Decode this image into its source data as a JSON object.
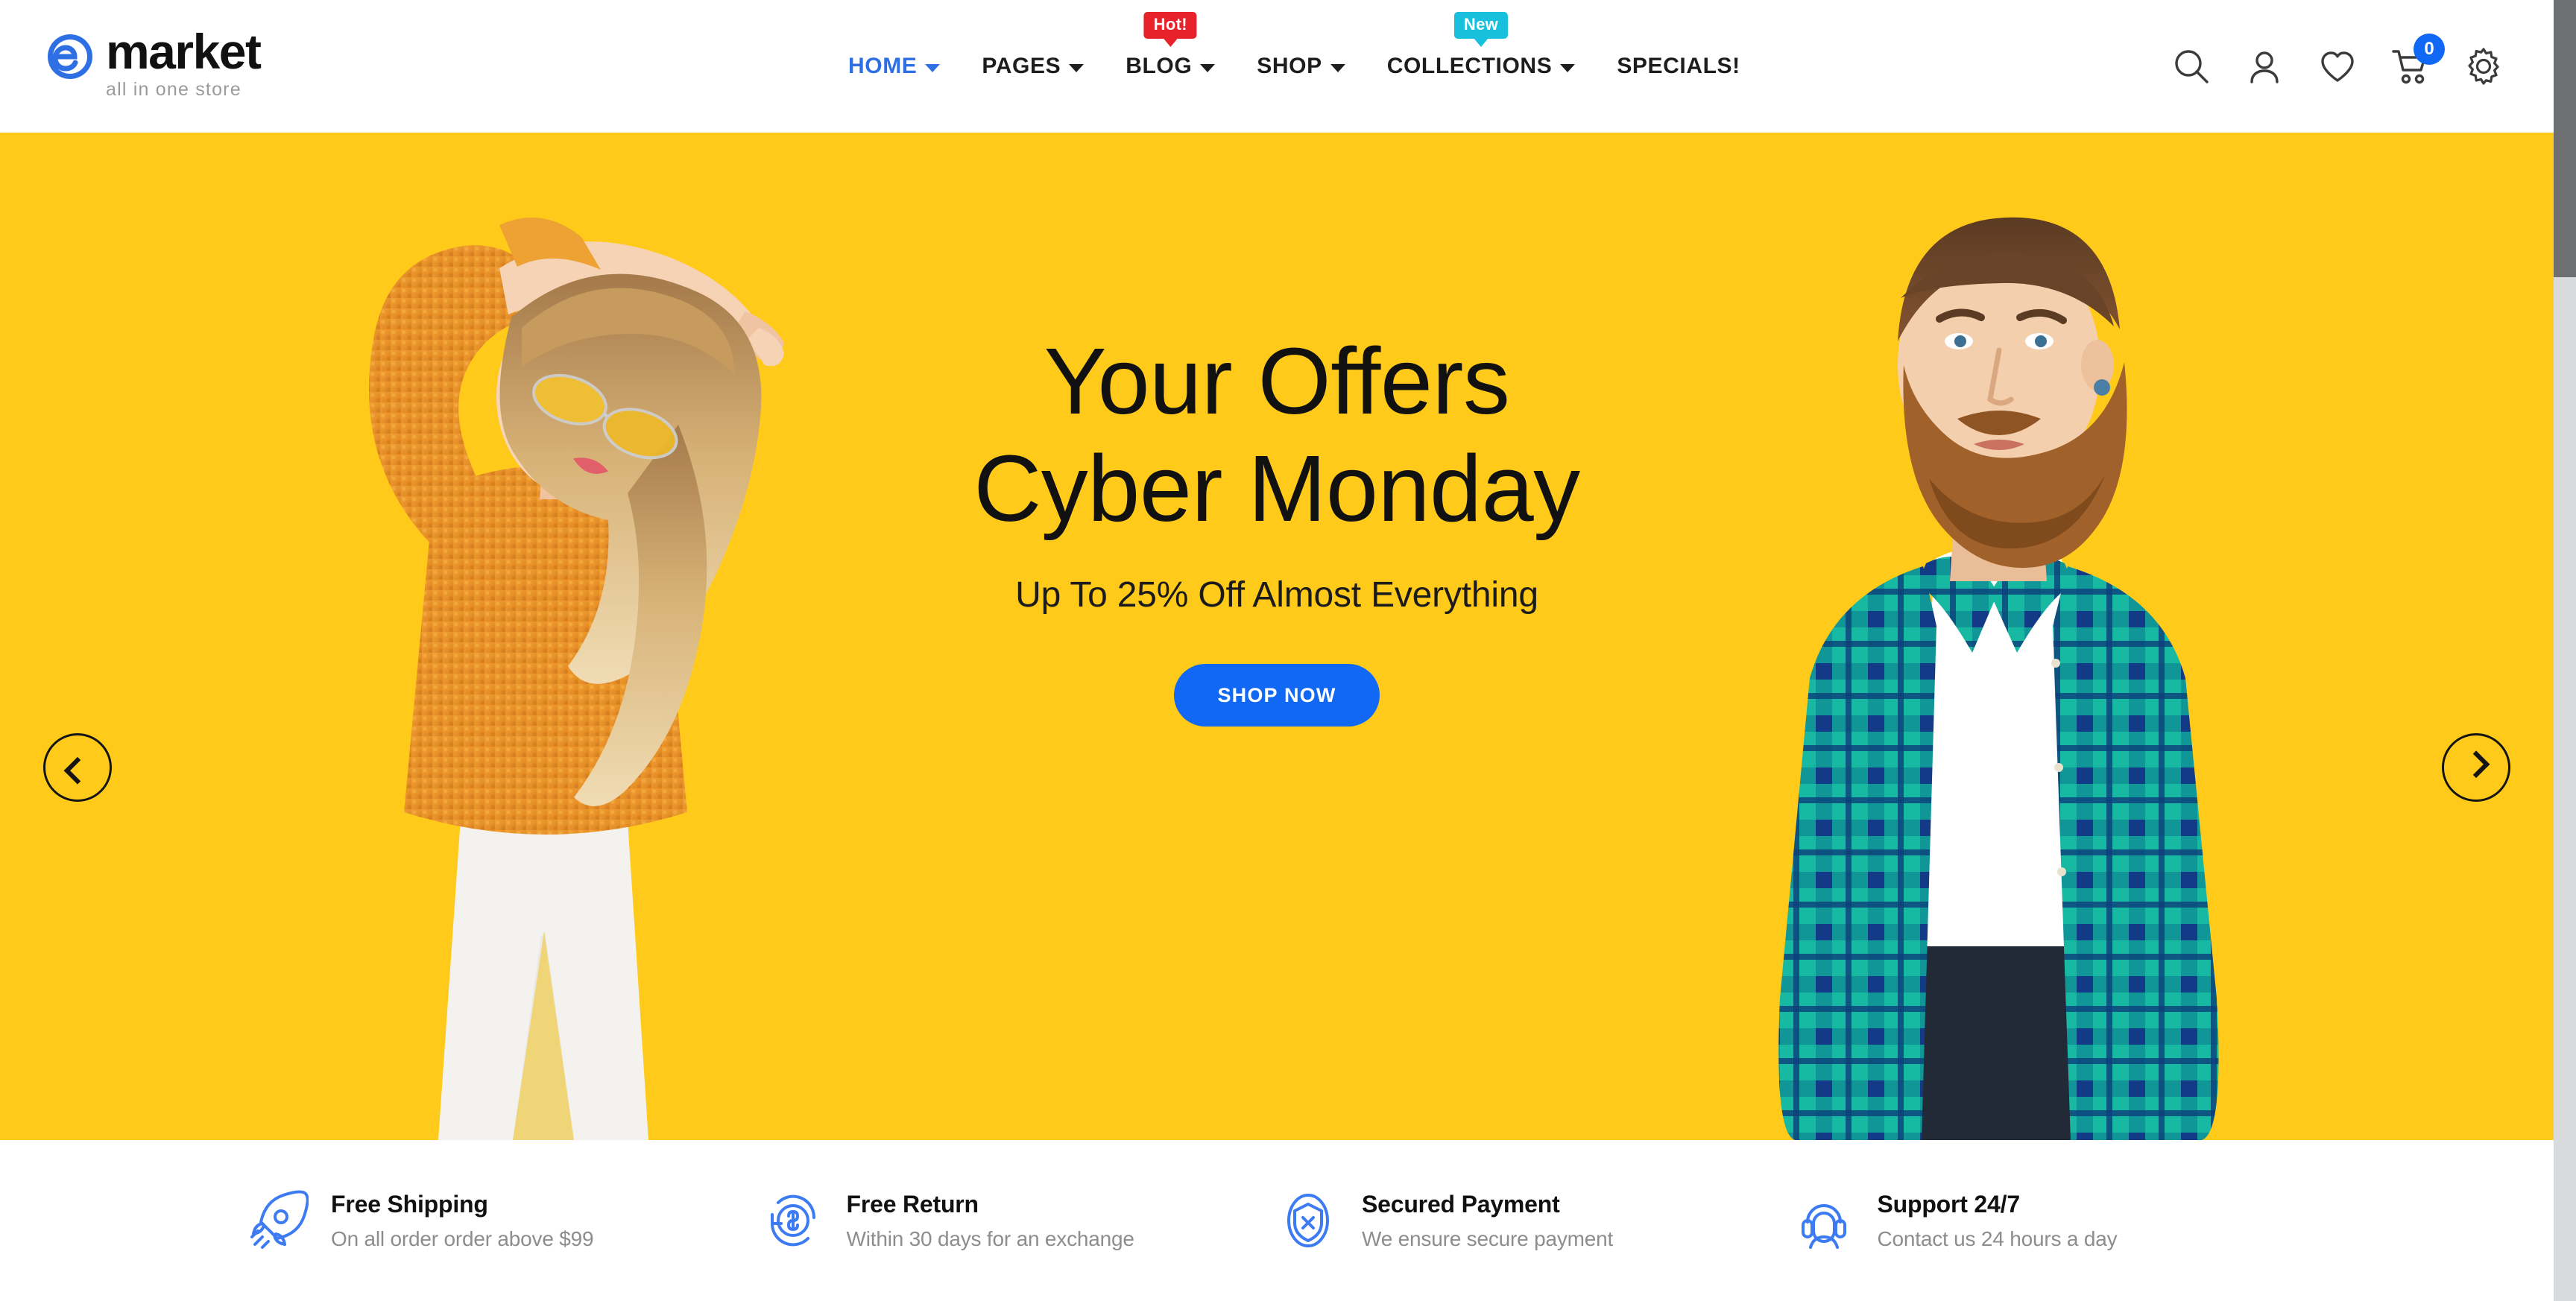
{
  "brand": {
    "name": "market",
    "tagline": "all in one store",
    "logo_icon": "emarket-e-logo",
    "accent_color": "#1168f5"
  },
  "nav": {
    "items": [
      {
        "label": "HOME",
        "has_caret": true,
        "active": true,
        "badge": null,
        "badge_type": null
      },
      {
        "label": "PAGES",
        "has_caret": true,
        "active": false,
        "badge": null,
        "badge_type": null
      },
      {
        "label": "BLOG",
        "has_caret": true,
        "active": false,
        "badge": "Hot!",
        "badge_type": "hot"
      },
      {
        "label": "SHOP",
        "has_caret": true,
        "active": false,
        "badge": null,
        "badge_type": null
      },
      {
        "label": "COLLECTIONS",
        "has_caret": true,
        "active": false,
        "badge": "New",
        "badge_type": "new"
      },
      {
        "label": "SPECIALS!",
        "has_caret": false,
        "active": false,
        "badge": null,
        "badge_type": null
      }
    ],
    "badge_colors": {
      "hot": "#e8222b",
      "new": "#18c0dd"
    }
  },
  "header_icons": {
    "search": "search-icon",
    "account": "user-icon",
    "wishlist": "heart-icon",
    "cart": "cart-icon",
    "cart_count": "0",
    "settings": "gear-icon"
  },
  "hero": {
    "background_color": "#ffca19",
    "title_line1": "Your Offers",
    "title_line2": "Cyber Monday",
    "subtitle": "Up To 25% Off Almost Everything",
    "cta_label": "SHOP NOW",
    "prev_arrow": "chevron-left-icon",
    "next_arrow": "chevron-right-icon",
    "left_image_alt": "woman in orange knit sweater with yellow sunglasses",
    "right_image_alt": "bearded man in teal plaid shirt over white t-shirt"
  },
  "features": [
    {
      "icon": "rocket-icon",
      "title": "Free Shipping",
      "desc": "On all order order above $99"
    },
    {
      "icon": "refund-icon",
      "title": "Free Return",
      "desc": "Within 30 days for an exchange"
    },
    {
      "icon": "shield-icon",
      "title": "Secured Payment",
      "desc": "We ensure secure payment"
    },
    {
      "icon": "headset-icon",
      "title": "Support 24/7",
      "desc": "Contact us 24 hours a day"
    }
  ]
}
